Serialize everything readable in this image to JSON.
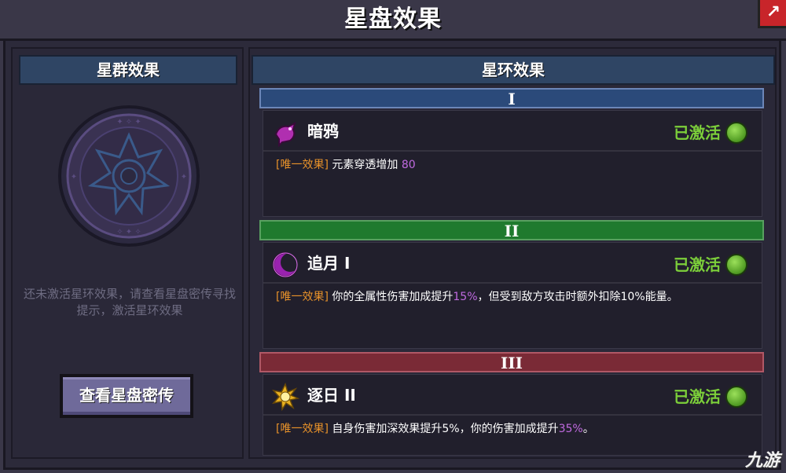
{
  "title": "星盘效果",
  "close_label": "↗",
  "left_panel": {
    "header": "星群效果",
    "hint": "还未激活星环效果，请查看星盘密传寻找提示，激活星环效果",
    "button_label": "查看星盘密传"
  },
  "right_panel": {
    "header": "星环效果",
    "tiers": [
      {
        "label": "I",
        "name": "暗鸦",
        "icon": "crow-icon",
        "status": "已激活",
        "tag": "[唯一效果]",
        "desc_parts": [
          "元素穿透增加 ",
          "80",
          ""
        ]
      },
      {
        "label": "II",
        "name": "追月 I",
        "icon": "moon-icon",
        "status": "已激活",
        "tag": "[唯一效果]",
        "desc_parts": [
          "你的全属性伤害加成提升",
          "15%",
          "，但受到敌方攻击时额外扣除10%能量。"
        ]
      },
      {
        "label": "III",
        "name": "逐日 II",
        "icon": "sun-icon",
        "status": "已激活",
        "tag": "[唯一效果]",
        "desc_parts": [
          "自身伤害加深效果提升5%，你的伤害加成提升",
          "35%",
          "。"
        ]
      }
    ]
  },
  "watermark": "九游",
  "colors": {
    "accent_purple": "#c06ae0",
    "tag_orange": "#e8922a",
    "active_green": "#7ccf3a"
  }
}
